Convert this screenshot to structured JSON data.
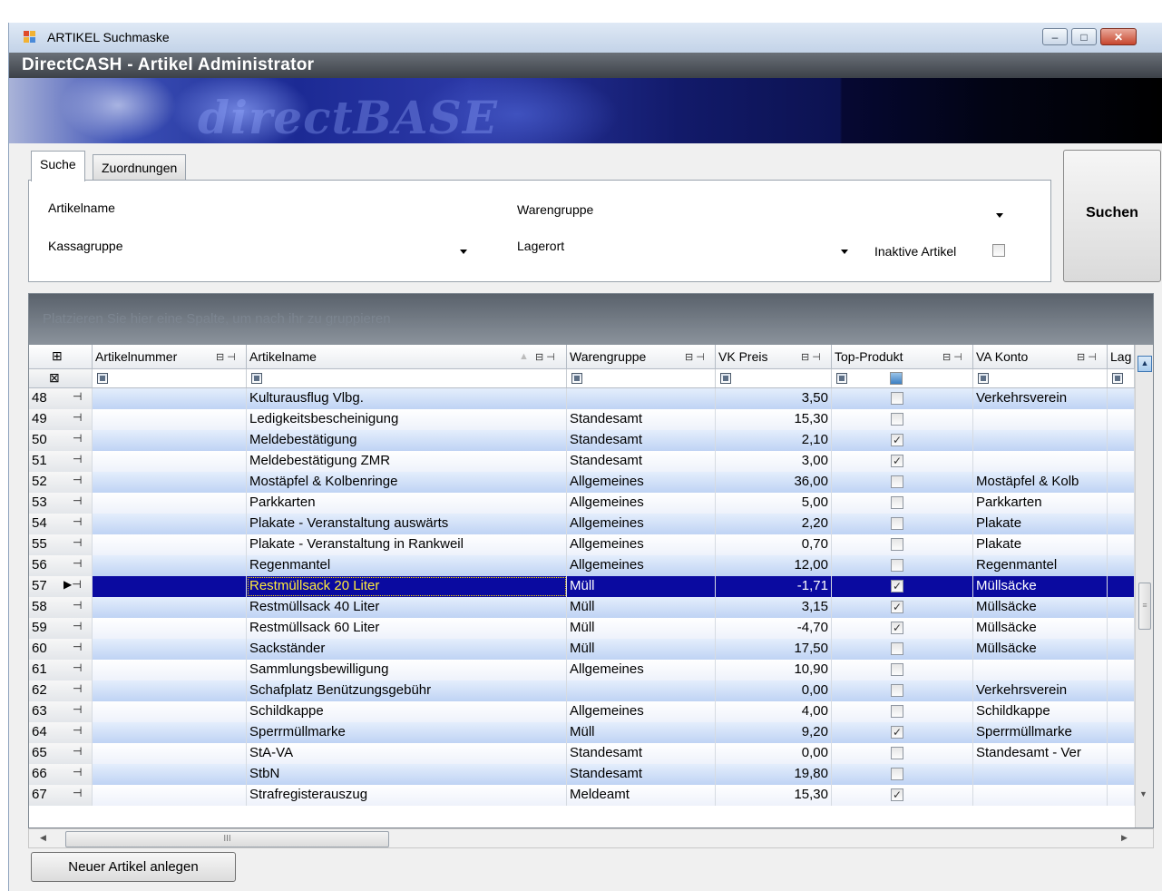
{
  "window": {
    "title": "ARTIKEL Suchmaske",
    "minimize": "–",
    "maximize": "□",
    "close": "✕"
  },
  "app_header": "DirectCASH - Artikel Administrator",
  "banner_logo": "directBASE",
  "tabs": [
    {
      "label": "Suche",
      "active": true
    },
    {
      "label": "Zuordnungen",
      "active": false
    }
  ],
  "search_form": {
    "artikelname_label": "Artikelname",
    "warengruppe_label": "Warengruppe",
    "kassagruppe_label": "Kassagruppe",
    "lagerort_label": "Lagerort",
    "inaktive_label": "Inaktive Artikel",
    "inaktive_checked": false
  },
  "search_button": "Suchen",
  "grid": {
    "group_hint": "Platzieren Sie hier eine Spalte, um nach ihr zu gruppieren",
    "columns": [
      "Artikelnummer",
      "Artikelname",
      "Warengruppe",
      "VK Preis",
      "Top-Produkt",
      "VA Konto",
      "Lag"
    ],
    "rows": [
      {
        "n": "48",
        "nr": "",
        "name": "Kulturausflug Vlbg.",
        "wg": "",
        "vk": "3,50",
        "top": false,
        "va": "Verkehrsverein"
      },
      {
        "n": "49",
        "nr": "",
        "name": "Ledigkeitsbescheinigung",
        "wg": "Standesamt",
        "vk": "15,30",
        "top": false,
        "va": ""
      },
      {
        "n": "50",
        "nr": "",
        "name": "Meldebestätigung",
        "wg": "Standesamt",
        "vk": "2,10",
        "top": true,
        "va": ""
      },
      {
        "n": "51",
        "nr": "",
        "name": "Meldebestätigung ZMR",
        "wg": "Standesamt",
        "vk": "3,00",
        "top": true,
        "va": ""
      },
      {
        "n": "52",
        "nr": "",
        "name": "Mostäpfel & Kolbenringe",
        "wg": "Allgemeines",
        "vk": "36,00",
        "top": false,
        "va": "Mostäpfel & Kolb"
      },
      {
        "n": "53",
        "nr": "",
        "name": "Parkkarten",
        "wg": "Allgemeines",
        "vk": "5,00",
        "top": false,
        "va": "Parkkarten"
      },
      {
        "n": "54",
        "nr": "",
        "name": "Plakate - Veranstaltung auswärts",
        "wg": "Allgemeines",
        "vk": "2,20",
        "top": false,
        "va": "Plakate"
      },
      {
        "n": "55",
        "nr": "",
        "name": "Plakate - Veranstaltung in Rankweil",
        "wg": "Allgemeines",
        "vk": "0,70",
        "top": false,
        "va": "Plakate"
      },
      {
        "n": "56",
        "nr": "",
        "name": "Regenmantel",
        "wg": "Allgemeines",
        "vk": "12,00",
        "top": false,
        "va": "Regenmantel"
      },
      {
        "n": "57",
        "nr": "",
        "name": "Restmüllsack 20 Liter",
        "wg": "Müll",
        "vk": "-1,71",
        "top": true,
        "va": "Müllsäcke",
        "selected": true
      },
      {
        "n": "58",
        "nr": "",
        "name": "Restmüllsack 40 Liter",
        "wg": "Müll",
        "vk": "3,15",
        "top": true,
        "va": "Müllsäcke"
      },
      {
        "n": "59",
        "nr": "",
        "name": "Restmüllsack 60 Liter",
        "wg": "Müll",
        "vk": "-4,70",
        "top": true,
        "va": "Müllsäcke"
      },
      {
        "n": "60",
        "nr": "",
        "name": "Sackständer",
        "wg": "Müll",
        "vk": "17,50",
        "top": false,
        "va": "Müllsäcke"
      },
      {
        "n": "61",
        "nr": "",
        "name": "Sammlungsbewilligung",
        "wg": "Allgemeines",
        "vk": "10,90",
        "top": false,
        "va": ""
      },
      {
        "n": "62",
        "nr": "",
        "name": "Schafplatz Benützungsgebühr",
        "wg": "",
        "vk": "0,00",
        "top": false,
        "va": "Verkehrsverein"
      },
      {
        "n": "63",
        "nr": "",
        "name": "Schildkappe",
        "wg": "Allgemeines",
        "vk": "4,00",
        "top": false,
        "va": "Schildkappe"
      },
      {
        "n": "64",
        "nr": "",
        "name": "Sperrmüllmarke",
        "wg": "Müll",
        "vk": "9,20",
        "top": true,
        "va": "Sperrmüllmarke"
      },
      {
        "n": "65",
        "nr": "",
        "name": "StA-VA",
        "wg": "Standesamt",
        "vk": "0,00",
        "top": false,
        "va": "Standesamt - Ver"
      },
      {
        "n": "66",
        "nr": "",
        "name": "StbN",
        "wg": "Standesamt",
        "vk": "19,80",
        "top": false,
        "va": ""
      },
      {
        "n": "67",
        "nr": "",
        "name": "Strafregisterauszug",
        "wg": "Meldeamt",
        "vk": "15,30",
        "top": true,
        "va": ""
      }
    ]
  },
  "new_article_button": "Neuer Artikel anlegen",
  "colors": {
    "selection": "#0a0aa0",
    "header_dark": "#3c4148",
    "row_alt": "#c9daf5"
  }
}
